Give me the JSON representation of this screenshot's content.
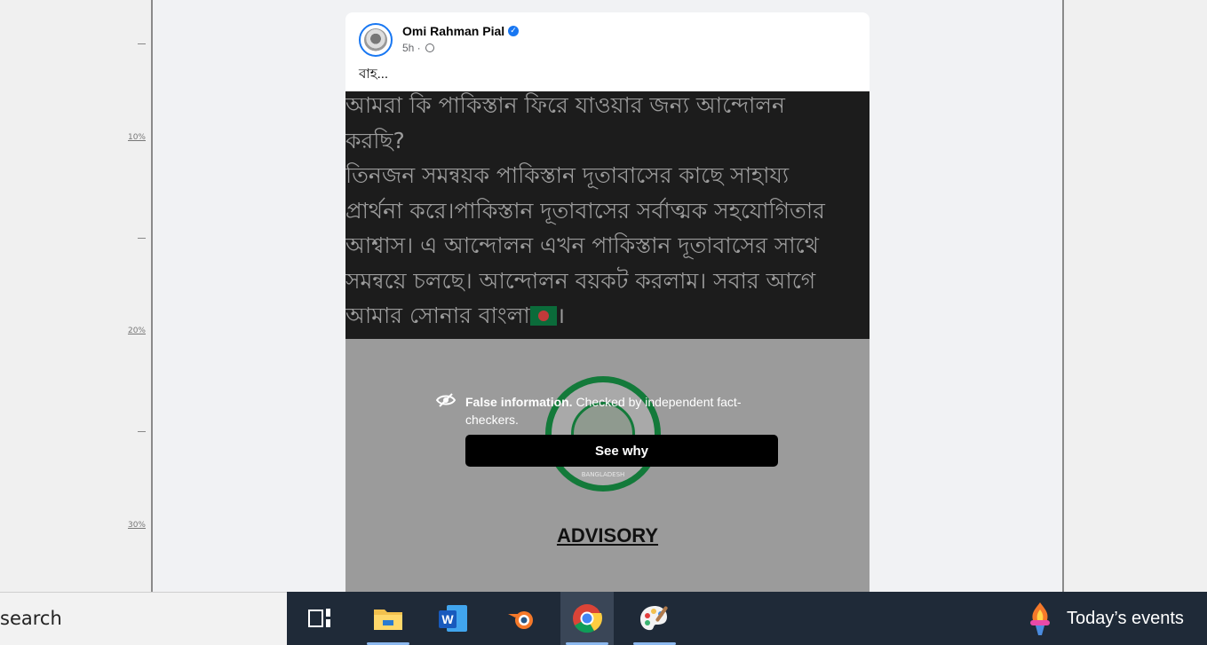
{
  "ruler": {
    "ticks": [
      "10%",
      "20%",
      "30%"
    ]
  },
  "post": {
    "author": "Omi Rahman Pial",
    "time": "5h ·",
    "text": "বাহ...",
    "image_lines": [
      "আমরা কি পাকিস্তান ফিরে যাওয়ার জন্য আন্দোলন",
      "করছি?",
      "তিনজন সমন্বয়ক পাকিস্তান দূতাবাসের কাছে সাহায্য",
      "প্রার্থনা করে।পাকিস্তান দূতাবাসের সর্বাত্মক সহযোগিতার",
      "আশ্বাস। এ আন্দোলন এখন পাকিস্তান দূতাবাসের সাথে",
      "সমন্বয়ে চলছে। আন্দোলন বয়কট করলাম। সবার আগে",
      "আমার সোনার বাংলা"
    ],
    "image_last_suffix": "।",
    "advisory": "ADVISORY",
    "seal_bottom": "BANGLADESH"
  },
  "fact_check": {
    "label": "False information.",
    "detail": " Checked by independent fact-checkers.",
    "button": "See why"
  },
  "taskbar": {
    "search_label": "search",
    "apps": [
      "task-view",
      "file-explorer",
      "word",
      "blender",
      "chrome",
      "paint"
    ],
    "widget_text": "Today’s events"
  },
  "colors": {
    "taskbar": "#1f2a38",
    "verified": "#1877f2",
    "seal_green": "#137a3a"
  }
}
